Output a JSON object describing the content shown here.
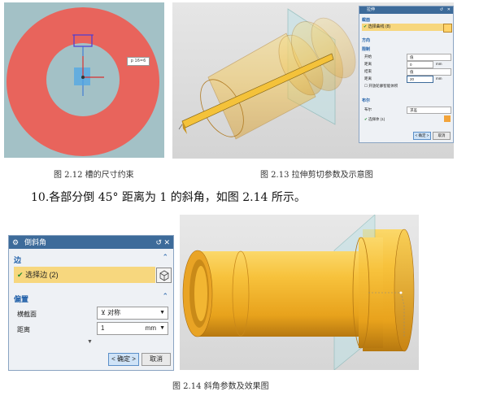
{
  "fig212": {
    "caption": "图 2.12 槽的尺寸约束",
    "dimension_tag": "p 16=6"
  },
  "fig213": {
    "caption": "图 2.13 拉伸剪切参数及示意图",
    "panel": {
      "title": "拉伸",
      "sec_section": "截面",
      "select_curve": "选择曲线 (8)",
      "sec_direction": "方向",
      "sec_limits": "限制",
      "start_label": "开始",
      "start_value": "值",
      "distance_label": "距离",
      "distance_value": "0",
      "end_label": "结束",
      "end_value": "值",
      "distance2_label": "距离",
      "distance2_value": "20",
      "unit": "mm",
      "open_profile": "开放轮廓智能体积",
      "sec_boolean": "布尔",
      "boolean_label": "布尔",
      "boolean_value": "求差",
      "select_body": "选择体 (1)",
      "ok": "< 确定 >",
      "cancel": "取消"
    }
  },
  "paragraph": "10.各部分倒 45° 距离为 1 的斜角，如图 2.14 所示。",
  "fig214": {
    "caption": "图 2.14 斜角参数及效果图",
    "dialog": {
      "title": "倒斜角",
      "sec_edge": "边",
      "select_edge": "选择边 (2)",
      "sec_offset": "偏置",
      "cross_section_label": "横截面",
      "cross_section_value": "对称",
      "distance_label": "距离",
      "distance_value": "1",
      "unit": "mm",
      "ok": "< 确定 >",
      "cancel": "取消"
    }
  }
}
